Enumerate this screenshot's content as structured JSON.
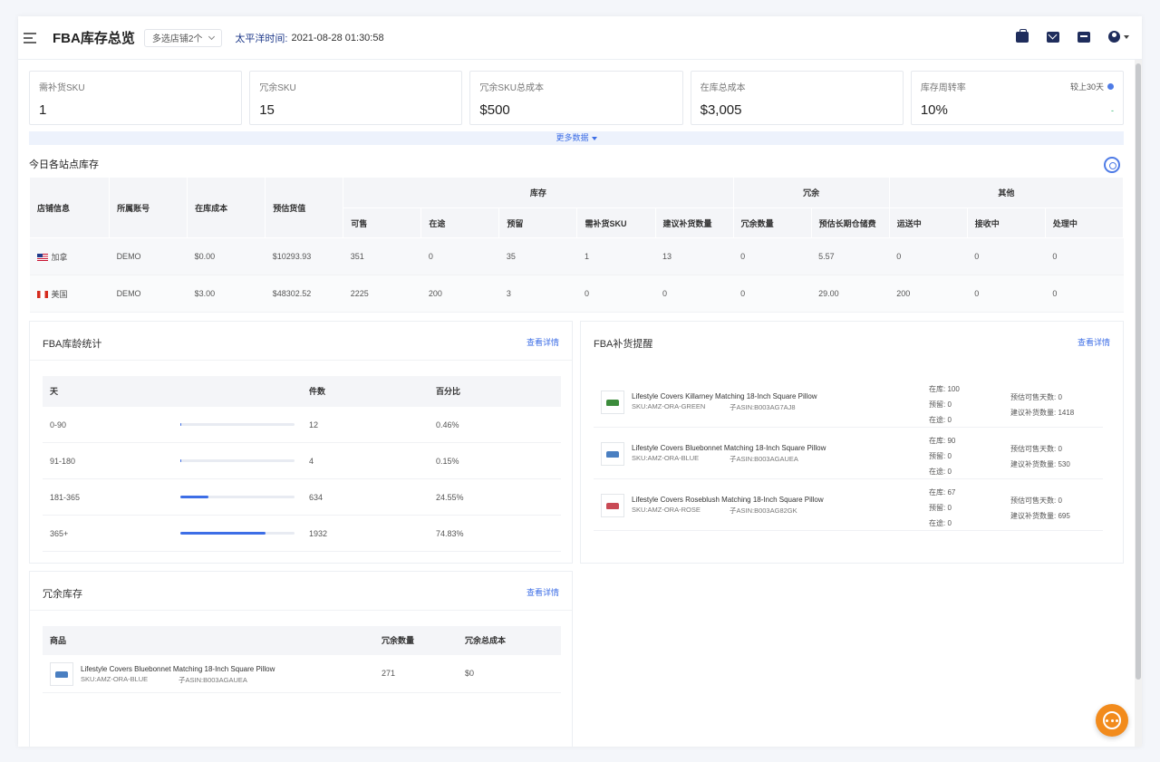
{
  "header": {
    "title": "FBA库存总览",
    "shop_select": "多选店铺2个",
    "timezone_label": "太平洋时间:",
    "timezone_time": "2021-08-28 01:30:58"
  },
  "kpis": [
    {
      "label": "需补货SKU",
      "value": "1"
    },
    {
      "label": "冗余SKU",
      "value": "15"
    },
    {
      "label": "冗余SKU总成本",
      "value": "$500"
    },
    {
      "label": "在库总成本",
      "value": "$3,005"
    },
    {
      "label": "库存周转率",
      "value": "10%",
      "extra": "较上30天",
      "trend": "-"
    }
  ],
  "more_data": "更多数据",
  "today_stock": {
    "title": "今日各站点库存",
    "headers": {
      "shop": "店铺信息",
      "account": "所属账号",
      "cost": "在库成本",
      "value": "预估货值",
      "group_stock": "库存",
      "group_excess": "冗余",
      "group_other": "其他",
      "available": "可售",
      "inbound": "在途",
      "reserved": "预留",
      "need_sku": "需补货SKU",
      "suggest_qty": "建议补货数量",
      "excess_qty": "冗余数量",
      "longterm_fee": "预估长期仓储费",
      "shipping": "运送中",
      "receiving": "接收中",
      "processing": "处理中"
    },
    "rows": [
      {
        "shop": "加拿",
        "account": "DEMO",
        "cost": "$0.00",
        "value": "$10293.93",
        "available": "351",
        "inbound": "0",
        "reserved": "35",
        "need_sku": "1",
        "suggest_qty": "13",
        "excess_qty": "0",
        "longterm_fee": "5.57",
        "shipping": "0",
        "receiving": "0",
        "processing": "0"
      },
      {
        "shop": "美国",
        "account": "DEMO",
        "cost": "$3.00",
        "value": "$48302.52",
        "available": "2225",
        "inbound": "200",
        "reserved": "3",
        "need_sku": "0",
        "suggest_qty": "0",
        "excess_qty": "0",
        "longterm_fee": "29.00",
        "shipping": "200",
        "receiving": "0",
        "processing": "0"
      }
    ]
  },
  "age_stats": {
    "title": "FBA库龄统计",
    "link": "查看详情",
    "headers": {
      "days": "天",
      "qty": "件数",
      "pct": "百分比"
    },
    "rows": [
      {
        "days": "0-90",
        "qty": "12",
        "pct": "0.46%",
        "share": 0.0046
      },
      {
        "days": "91-180",
        "qty": "4",
        "pct": "0.15%",
        "share": 0.0015
      },
      {
        "days": "181-365",
        "qty": "634",
        "pct": "24.55%",
        "share": 0.2455
      },
      {
        "days": "365+",
        "qty": "1932",
        "pct": "74.83%",
        "share": 0.7483
      }
    ]
  },
  "replenish": {
    "title": "FBA补货提醒",
    "link": "查看详情",
    "items": [
      {
        "name": "Lifestyle Covers Killarney Matching 18-Inch Square Pillow",
        "sku": "SKU:AMZ-ORA-GREEN",
        "asin": "子ASIN:B003AG7AJ8",
        "available": "在库: 100",
        "reserved": "预留: 0",
        "inbound": "在途: 0",
        "days": "预估可售天数: 0",
        "suggest": "建议补货数量: 1418",
        "color": "#3c8c3c"
      },
      {
        "name": "Lifestyle Covers Bluebonnet Matching 18-Inch Square Pillow",
        "sku": "SKU:AMZ-ORA-BLUE",
        "asin": "子ASIN:B003AGAUEA",
        "available": "在库: 90",
        "reserved": "预留: 0",
        "inbound": "在途: 0",
        "days": "预估可售天数: 0",
        "suggest": "建议补货数量: 530",
        "color": "#4a7fc1"
      },
      {
        "name": "Lifestyle Covers Roseblush Matching 18-Inch Square Pillow",
        "sku": "SKU:AMZ-ORA-ROSE",
        "asin": "子ASIN:B003AG82GK",
        "available": "在库: 67",
        "reserved": "预留: 0",
        "inbound": "在途: 0",
        "days": "预估可售天数: 0",
        "suggest": "建议补货数量: 695",
        "color": "#c94a55"
      }
    ]
  },
  "excess": {
    "title": "冗余库存",
    "link": "查看详情",
    "headers": {
      "product": "商品",
      "qty": "冗余数量",
      "cost": "冗余总成本"
    },
    "rows": [
      {
        "name": "Lifestyle Covers Bluebonnet Matching 18-Inch Square Pillow",
        "sku": "SKU:AMZ-ORA-BLUE",
        "asin": "子ASIN:B003AGAUEA",
        "qty": "271",
        "cost": "$0",
        "color": "#4a7fc1"
      }
    ]
  }
}
